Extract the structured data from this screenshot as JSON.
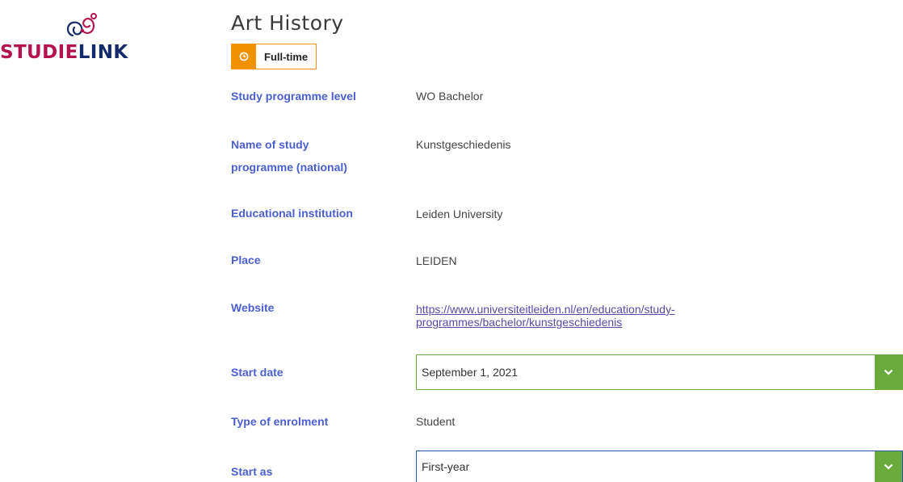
{
  "brand": {
    "logo_part1": "STUDIE",
    "logo_part2": "LINK",
    "primary_color": "#b4124f",
    "secondary_color": "#152a6b"
  },
  "programme": {
    "title": "Art History",
    "badge": {
      "label": "Full-time",
      "icon": "clock-icon",
      "color": "#f39200"
    }
  },
  "details": {
    "level": {
      "label": "Study programme level",
      "value": "WO Bachelor"
    },
    "name_national": {
      "label_line1": "Name of study",
      "label_line2": "programme (national)",
      "value": "Kunstgeschiedenis"
    },
    "institution": {
      "label": "Educational institution",
      "value": "Leiden University"
    },
    "place": {
      "label": "Place",
      "value": "LEIDEN"
    },
    "website": {
      "label": "Website",
      "value_line1": "https://www.universiteitleiden.nl/en/education/study-",
      "value_line2": "programmes/bachelor/kunstgeschiedenis"
    },
    "start_date": {
      "label": "Start date",
      "value": "September 1, 2021"
    },
    "enrolment_type": {
      "label": "Type of enrolment",
      "value": "Student"
    },
    "start_as": {
      "label": "Start as",
      "value": "First-year"
    }
  },
  "colors": {
    "label": "#4a5fcf",
    "select_accent": "#6bab3e",
    "focus_border": "#2a56a8"
  }
}
